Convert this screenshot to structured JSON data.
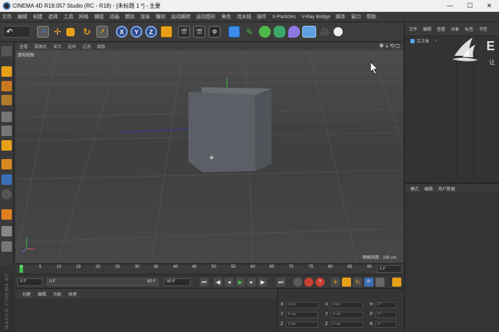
{
  "window": {
    "title": "CINEMA 4D R18.057 Studio (RC - R18) - [未标题 1 *] - 主要",
    "controls": [
      "—",
      "☐",
      "✕"
    ]
  },
  "menubar": {
    "items": [
      "文件",
      "编辑",
      "创建",
      "选择",
      "工具",
      "网格",
      "捕捉",
      "动画",
      "模拟",
      "渲染",
      "雕刻",
      "运动跟踪",
      "运动图形",
      "角色",
      "流水线",
      "插件",
      "X-Particles",
      "V-Ray Bridge",
      "脚本",
      "窗口",
      "帮助"
    ]
  },
  "toolbar": {
    "axis_buttons": [
      "X",
      "Y",
      "Z"
    ]
  },
  "viewport": {
    "menu": [
      "查看",
      "摄像机",
      "显示",
      "选项",
      "过滤",
      "面板"
    ],
    "nav_icons": "✥⇣⟲◻",
    "label": "透视视图",
    "grid_distance": "网格间距 : 100 cm"
  },
  "object_manager": {
    "tabs": [
      "文件",
      "编辑",
      "查看",
      "对象",
      "标签",
      "书签"
    ],
    "objects": [
      {
        "name": "立方体"
      }
    ]
  },
  "attribute_manager": {
    "tabs": [
      "模式",
      "编辑",
      "用户数据"
    ]
  },
  "timeline": {
    "ticks": [
      "0",
      "5",
      "10",
      "15",
      "20",
      "25",
      "30",
      "35",
      "40",
      "45",
      "50",
      "55",
      "60",
      "65",
      "70",
      "75",
      "80",
      "85",
      "90"
    ],
    "current_frame": "0 F"
  },
  "transport": {
    "start_frame": "0 F",
    "slider_start": "0 F",
    "slider_end": "90 F",
    "end_frame": "90 F"
  },
  "material_manager": {
    "tabs": [
      "创建",
      "编辑",
      "功能",
      "纹理"
    ]
  },
  "coordinates": {
    "rows": [
      {
        "a": "X",
        "av": "0 cm",
        "b": "X",
        "bv": "0 cm",
        "c": "H",
        "cv": "0 °"
      },
      {
        "a": "Y",
        "av": "0 cm",
        "b": "Y",
        "bv": "0 cm",
        "c": "P",
        "cv": "0 °"
      },
      {
        "a": "Z",
        "av": "0 cm",
        "b": "Z",
        "bv": "0 cm",
        "c": "B",
        "cv": "0 °"
      }
    ]
  },
  "branding": {
    "side_text": "MAXON CINEMA 4D",
    "logo_text": "让"
  },
  "colors": {
    "accent_blue": "#4a7ec2",
    "playhead_green": "#3cc24a",
    "viewport_bg": "#4a4a4a"
  }
}
